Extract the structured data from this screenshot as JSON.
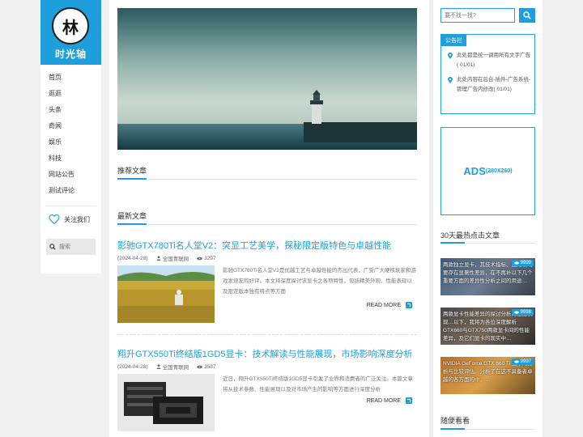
{
  "site": {
    "logo_glyph": "林",
    "name": "时光轴"
  },
  "nav": {
    "items": [
      {
        "label": "首页"
      },
      {
        "label": "逛逛"
      },
      {
        "label": "头条"
      },
      {
        "label": "奇闻"
      },
      {
        "label": "娱乐"
      },
      {
        "label": "科技"
      },
      {
        "label": "网站公告"
      },
      {
        "label": "测试评论"
      }
    ],
    "follow_label": "关注我们",
    "search_placeholder": "搜索"
  },
  "main": {
    "recommend_title": "推荐文章",
    "latest_title": "最新文章",
    "articles": [
      {
        "title": "影驰GTX780Ti名人堂V2：突显工艺美学，探秘限定版特色与卓越性能",
        "date": "(2024-04-28)",
        "source": "全国青联网",
        "views": "3297",
        "summary": "影驰GTX780Ti名人堂V2是优越工艺与卓越性能的杰出代表，广受广大硬核玩家和游戏发烧友的好评。本文将深度探讨该显卡之各项特性，包括精美外观、性能表现以及限定版本独有特点等方面",
        "more": "READ MORE"
      },
      {
        "title": "翔升GTX550Ti终结版1GD5显卡：技术解读与性能展现，市场影响深度分析",
        "date": "(2024-04-28)",
        "source": "全国青联网",
        "views": "3587",
        "summary": "近日，翔升GTX550Ti终结版1GD5显卡引发了业界和消费者的广泛关注。本篇文章将从技术参数、性能展现以及对市场产生的影响等方面进行深度分析",
        "more": "READ MORE"
      }
    ]
  },
  "right": {
    "search_placeholder": "要不找一找?",
    "notice_title": "公告栏",
    "notices": [
      "此处都是统一调用所有文字广告( 01/01)",
      "此处内容在后台-插件-广告系统-管理广告内修改( 01/01)"
    ],
    "ads_main": "ADS",
    "ads_size": "(280X260)",
    "hot_title": "30天最热点击文章",
    "hot_items": [
      {
        "text": "两款独立显卡，其技术指标、应用领域要存在显著性差异，在不再补以下几个重要方面的差异性分析之间的用途…",
        "views": "9999"
      },
      {
        "text": "两款显卡性能差异的探讨分析的性能表现…以下，我将为各位深度解析GTX660与GTX750两款显卡间的性能差异，及它们显卡的现实中…",
        "views": "9998"
      },
      {
        "text": "NVIDIA GeForce GTX 660 Ti 显卡的分析与比较评估。分析了在这不具备者卓越的各方面的中，…",
        "views": "9997"
      }
    ],
    "random_title": "随便看看"
  },
  "colors": {
    "accent": "#1e9fdc"
  }
}
